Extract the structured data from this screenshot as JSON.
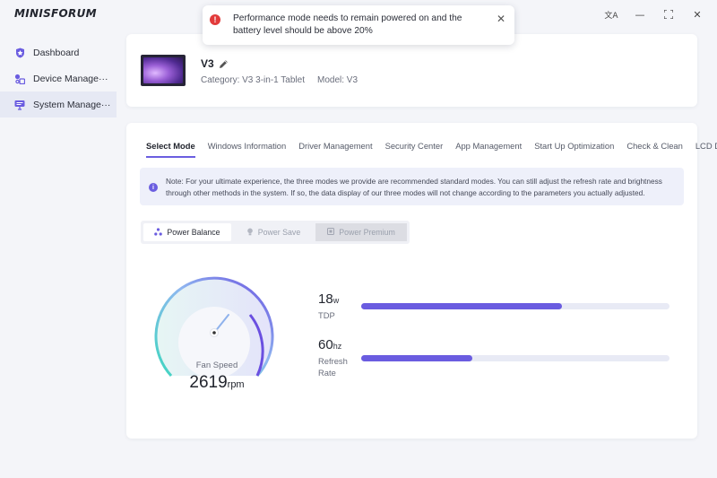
{
  "app": {
    "logo": "MINISFORUM"
  },
  "window_controls": {
    "translate": "文A",
    "minimize": "—",
    "maximize": "⛶",
    "close": "✕"
  },
  "sidebar": {
    "items": [
      {
        "label": "Dashboard",
        "icon": "shield-icon",
        "active": false
      },
      {
        "label": "Device Manage···",
        "icon": "device-icon",
        "active": false
      },
      {
        "label": "System Manage···",
        "icon": "system-icon",
        "active": true
      }
    ]
  },
  "toast": {
    "icon": "!",
    "message": "Performance mode needs to remain powered on and the battery level should be above 20%",
    "close": "✕",
    "color": "#e23b3b"
  },
  "device": {
    "name": "V3",
    "category": "Category: V3 3-in-1 Tablet",
    "model": "Model: V3"
  },
  "tabs": [
    {
      "label": "Select Mode",
      "active": true
    },
    {
      "label": "Windows Information"
    },
    {
      "label": "Driver Management"
    },
    {
      "label": "Security Center"
    },
    {
      "label": "App Management"
    },
    {
      "label": "Start Up Optimization"
    },
    {
      "label": "Check & Clean"
    },
    {
      "label": "LCD Display"
    }
  ],
  "note": {
    "icon": "i",
    "text": "Note: For your ultimate experience, the three modes we provide are recommended standard modes. You can still adjust the refresh rate and brightness through other methods in the system. If so, the data display of our three modes will not change according to the parameters you actually adjusted."
  },
  "modes": [
    {
      "label": "Power Balance",
      "state": "active"
    },
    {
      "label": "Power Save",
      "state": "normal"
    },
    {
      "label": "Power Premium",
      "state": "disabled"
    }
  ],
  "fan": {
    "label": "Fan Speed",
    "value": "2619",
    "unit": "rpm"
  },
  "metrics": {
    "tdp": {
      "value": "18",
      "unit": "w",
      "label": "TDP",
      "fraction": 0.65
    },
    "refresh": {
      "value": "60",
      "unit": "hz",
      "label": "Refresh Rate",
      "label_line1": "Refresh",
      "label_line2": "Rate",
      "fraction": 0.36
    }
  },
  "colors": {
    "accent": "#6a5ce0",
    "gauge_start": "#3fd6c0",
    "gauge_end": "#6a4fe0"
  }
}
